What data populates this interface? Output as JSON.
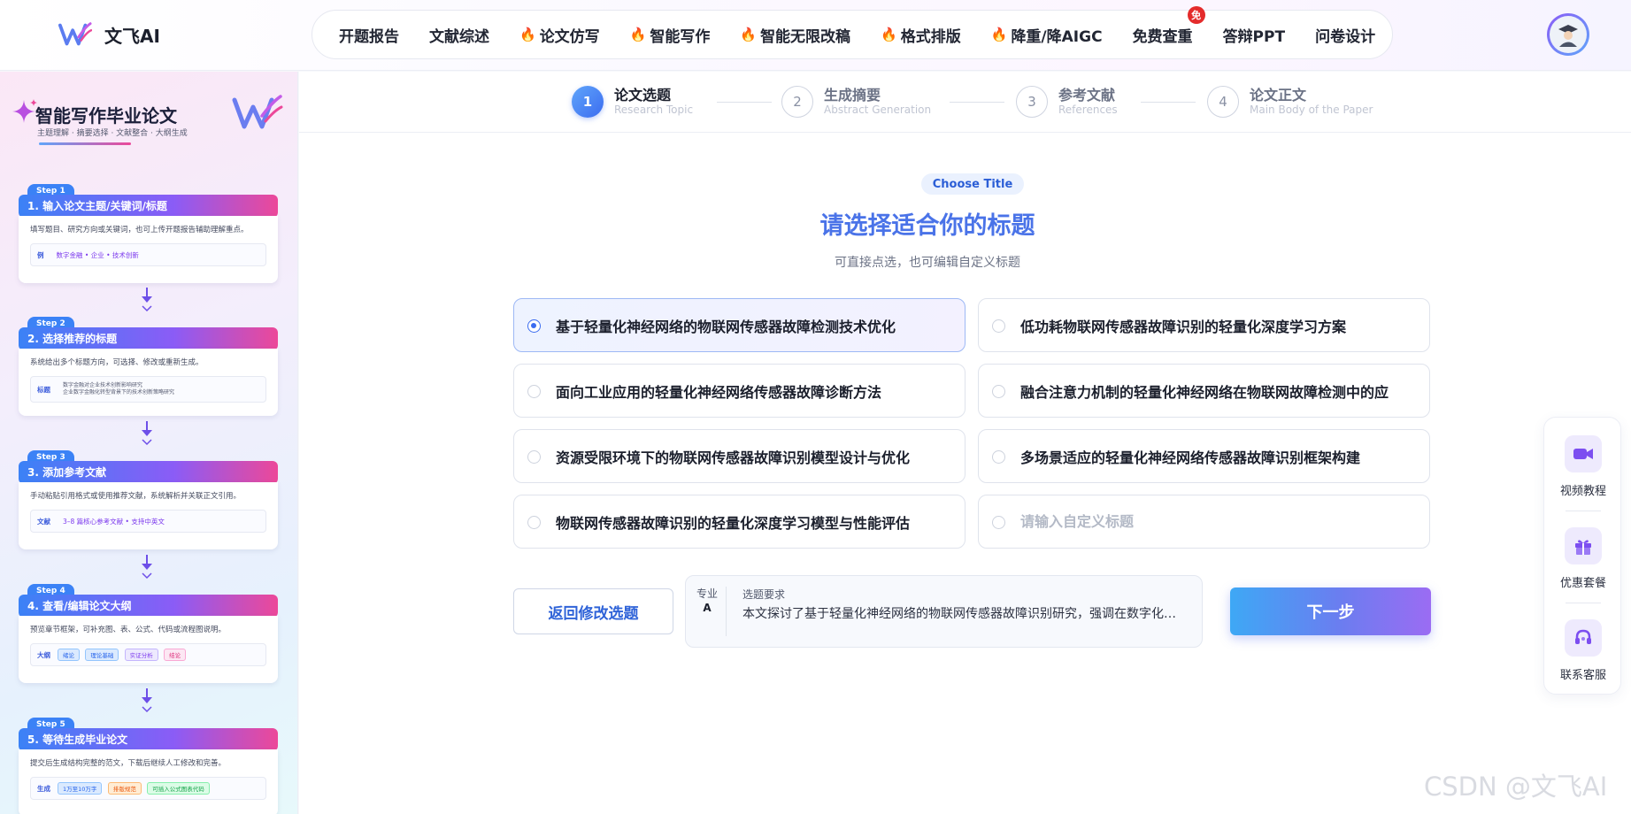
{
  "brand": {
    "name": "文飞AI"
  },
  "nav": [
    {
      "label": "开题报告",
      "hot": false
    },
    {
      "label": "文献综述",
      "hot": false
    },
    {
      "label": "论文仿写",
      "hot": true
    },
    {
      "label": "智能写作",
      "hot": true
    },
    {
      "label": "智能无限改稿",
      "hot": true
    },
    {
      "label": "格式排版",
      "hot": true
    },
    {
      "label": "降重/降AIGC",
      "hot": true
    },
    {
      "label": "免费查重",
      "hot": false,
      "badge": "免"
    },
    {
      "label": "答辩PPT",
      "hot": false
    },
    {
      "label": "问卷设计",
      "hot": false
    }
  ],
  "sidebar": {
    "title": "智能写作毕业论文",
    "subtitle": "主题理解 · 摘要选择 · 文献整合 · 大纲生成",
    "steps": [
      {
        "tag": "Step 1",
        "title": "1. 输入论文主题/关键词/标题",
        "desc": "填写题目、研究方向或关键词，也可上传开题报告辅助理解重点。",
        "ex_key": "例",
        "ex_text": "数字金融 • 企业 • 技术创新"
      },
      {
        "tag": "Step 2",
        "title": "2. 选择推荐的标题",
        "desc": "系统给出多个标题方向，可选择、修改或重新生成。",
        "ex_key": "标题",
        "ex_text": "数字金融对企业技术创新影响研究",
        "ex_text2": "企业数字金融化转型背景下的技术创新策略研究"
      },
      {
        "tag": "Step 3",
        "title": "3. 添加参考文献",
        "desc": "手动粘贴引用格式或使用推荐文献，系统解析并关联正文引用。",
        "ex_key": "文献",
        "ex_text": "3–8 篇核心参考文献 • 支持中英文"
      },
      {
        "tag": "Step 4",
        "title": "4. 查看/编辑论文大纲",
        "desc": "预览章节框架，可补充图、表、公式、代码或流程图说明。",
        "ex_key": "大纲",
        "chips": [
          "绪论",
          "理论基础",
          "实证分析",
          "结论"
        ]
      },
      {
        "tag": "Step 5",
        "title": "5. 等待生成毕业论文",
        "desc": "提交后生成结构完整的范文，下载后继续人工修改和完善。",
        "ex_key": "生成",
        "chips": [
          "1万至10万字",
          "排版规范",
          "可插入公式图表代码"
        ]
      }
    ]
  },
  "stepper": [
    {
      "num": "1",
      "title": "论文选题",
      "sub": "Research Topic",
      "active": true
    },
    {
      "num": "2",
      "title": "生成摘要",
      "sub": "Abstract Generation",
      "active": false
    },
    {
      "num": "3",
      "title": "参考文献",
      "sub": "References",
      "active": false
    },
    {
      "num": "4",
      "title": "论文正文",
      "sub": "Main Body of the Paper",
      "active": false
    }
  ],
  "main": {
    "tag": "Choose Title",
    "heading": "请选择适合你的标题",
    "subheading": "可直接点选，也可编辑自定义标题",
    "options": [
      "基于轻量化神经网络的物联网传感器故障检测技术优化",
      "低功耗物联网传感器故障识别的轻量化深度学习方案",
      "面向工业应用的轻量化神经网络传感器故障诊断方法",
      "融合注意力机制的轻量化神经网络在物联网故障检测中的应",
      "资源受限环境下的物联网传感器故障识别模型设计与优化",
      "多场景适应的轻量化神经网络传感器故障识别框架构建",
      "物联网传感器故障识别的轻量化深度学习模型与性能评估"
    ],
    "selected_index": 0,
    "custom_placeholder": "请输入自定义标题",
    "back_label": "返回修改选题",
    "req_left": "专业",
    "req_left2": "A",
    "req_title": "选题要求",
    "req_text": "本文探讨了基于轻量化神经网络的物联网传感器故障识别研究，强调在数字化转型背景下技术优化的重要性",
    "next_label": "下一步"
  },
  "float_menu": [
    {
      "label": "视频教程",
      "icon": "video-camera-icon"
    },
    {
      "label": "优惠套餐",
      "icon": "gift-icon"
    },
    {
      "label": "联系客服",
      "icon": "headset-icon"
    }
  ],
  "watermark": "CSDN @文飞AI",
  "colors": {
    "accent": "#3b6cf0",
    "heading": "#4a73e8",
    "hot": "#e8332b"
  }
}
